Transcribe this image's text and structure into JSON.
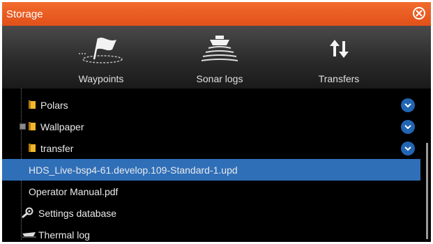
{
  "window": {
    "title": "Storage"
  },
  "toolbar": {
    "items": [
      {
        "label": "Waypoints",
        "icon": "waypoints-flag-icon"
      },
      {
        "label": "Sonar logs",
        "icon": "sonar-logs-icon"
      },
      {
        "label": "Transfers",
        "icon": "transfers-arrows-icon"
      }
    ]
  },
  "list": {
    "items": [
      {
        "label": "Polars",
        "type": "folder",
        "menu": true
      },
      {
        "label": "Wallpaper",
        "type": "folder",
        "expandable": true,
        "menu": true
      },
      {
        "label": "transfer",
        "type": "folder",
        "menu": true
      },
      {
        "label": "HDS_Live-bsp4-61.develop.109-Standard-1.upd",
        "type": "file",
        "selected": true
      },
      {
        "label": "Operator Manual.pdf",
        "type": "file"
      },
      {
        "label": "Settings database",
        "type": "settings"
      },
      {
        "label": "Thermal log",
        "type": "thermal"
      }
    ]
  },
  "colors": {
    "title_bar": "#e85d22",
    "selection": "#2f6fb8",
    "menu_button": "#2266b3",
    "folder": "#e8b020"
  }
}
